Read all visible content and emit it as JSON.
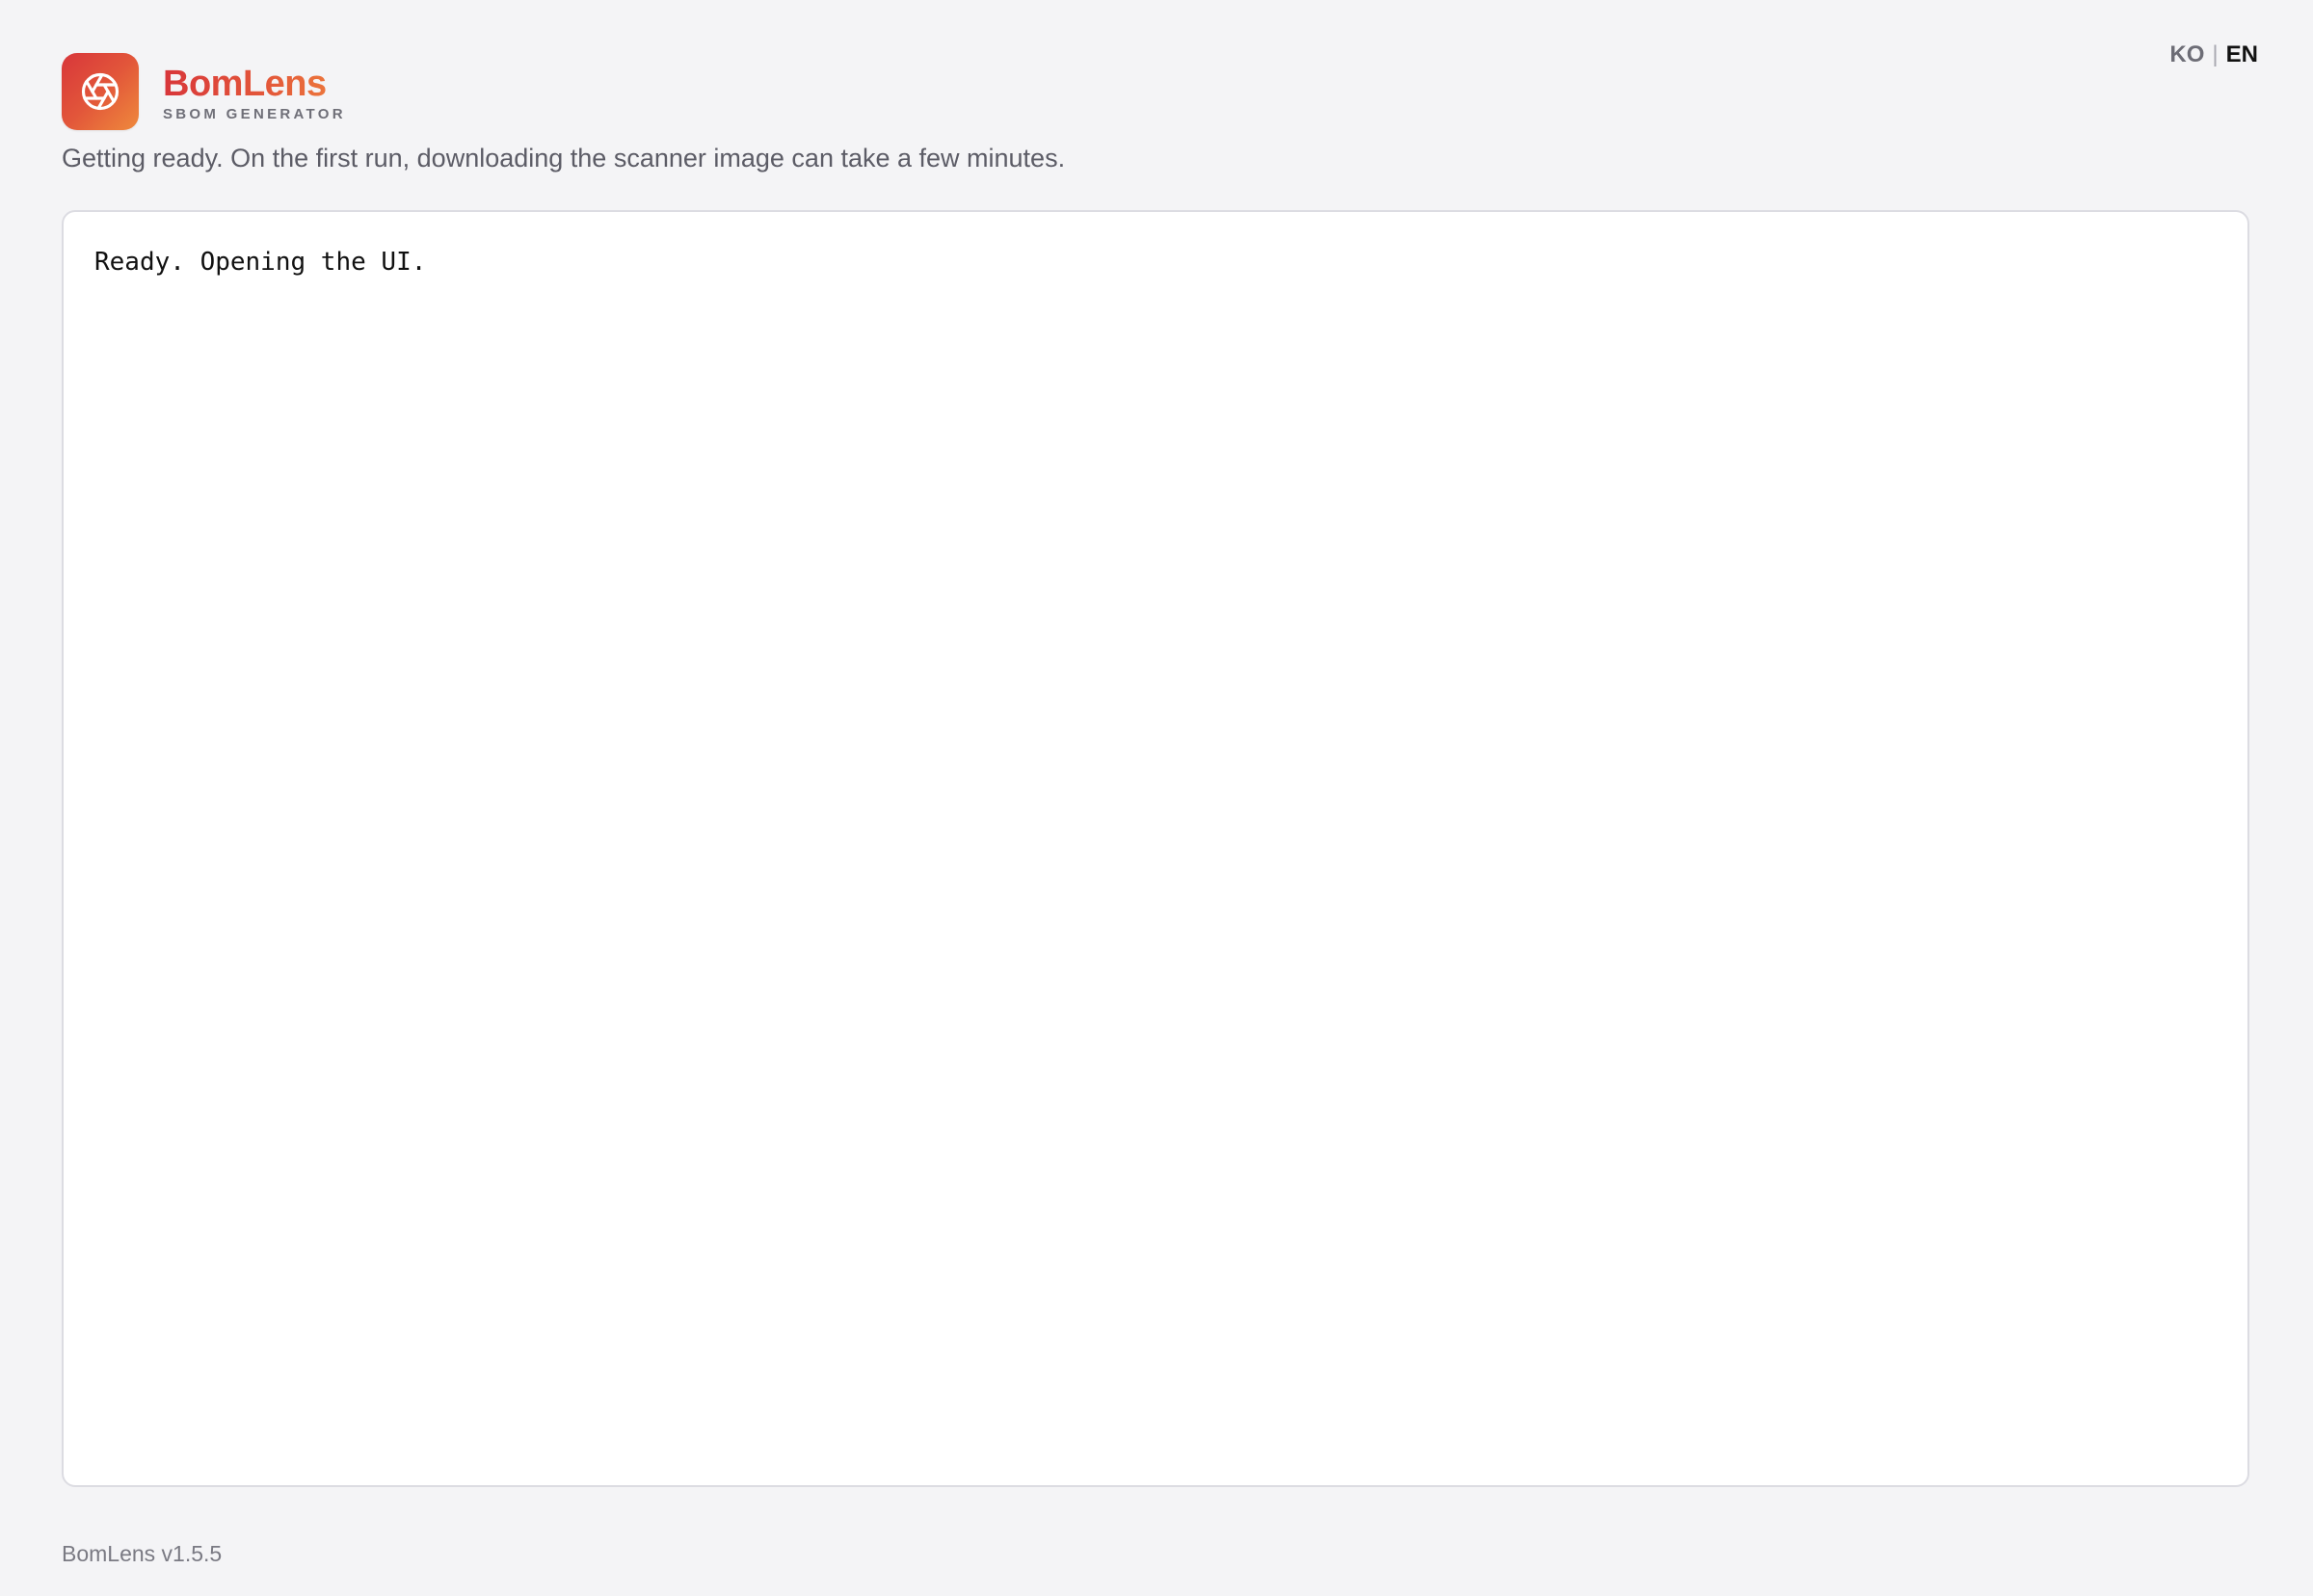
{
  "app": {
    "name": "BomLens",
    "tagline": "SBOM GENERATOR",
    "logo_icon": "aperture-icon",
    "brand_gradient": [
      "#d8363a",
      "#ef8a3c"
    ]
  },
  "language": {
    "options": [
      "KO",
      "EN"
    ],
    "separator": "|",
    "selected": "EN"
  },
  "status": {
    "message": "Getting ready. On the first run, downloading the scanner image can take a few minutes."
  },
  "log": {
    "lines": [
      "Ready. Opening the UI."
    ]
  },
  "footer": {
    "version_text": "BomLens v1.5.5"
  }
}
